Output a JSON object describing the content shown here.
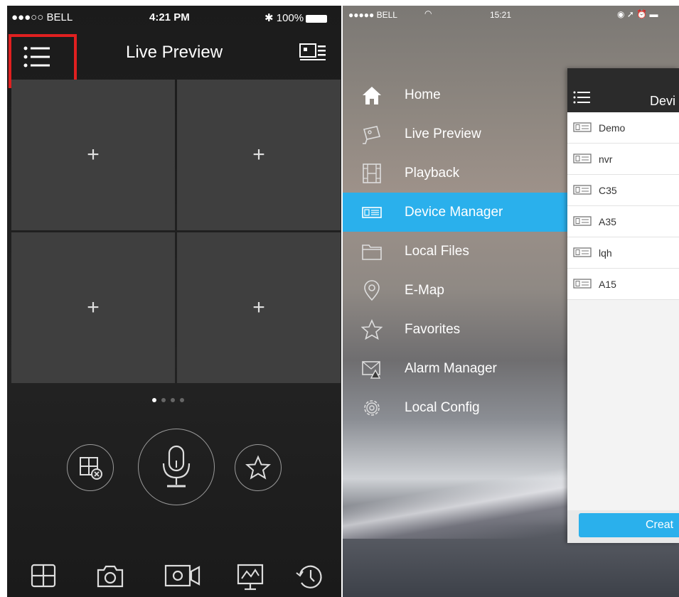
{
  "left_screen": {
    "status": {
      "carrier": "●●●○○ BELL",
      "time": "4:21 PM",
      "battery": "100%"
    },
    "title": "Live Preview",
    "pages_total": 4,
    "page_active": 1
  },
  "right_screen": {
    "status": {
      "carrier": "●●●●● BELL",
      "time": "15:21"
    },
    "menu": [
      {
        "label": "Home",
        "icon": "home-icon"
      },
      {
        "label": "Live Preview",
        "icon": "camera-icon"
      },
      {
        "label": "Playback",
        "icon": "film-icon"
      },
      {
        "label": "Device Manager",
        "icon": "device-icon",
        "active": true
      },
      {
        "label": "Local Files",
        "icon": "folder-icon"
      },
      {
        "label": "E-Map",
        "icon": "map-pin-icon"
      },
      {
        "label": "Favorites",
        "icon": "star-icon"
      },
      {
        "label": "Alarm Manager",
        "icon": "alarm-mail-icon"
      },
      {
        "label": "Local Config",
        "icon": "gear-icon"
      }
    ],
    "device_panel": {
      "title": "Devi",
      "devices": [
        "Demo",
        "nvr",
        "C35",
        "A35",
        "lqh",
        "A15"
      ],
      "create_label": "Creat"
    }
  },
  "colors": {
    "accent": "#2ab0ec",
    "highlight_box": "#e02020",
    "dark_bg": "#1e1e1e"
  }
}
